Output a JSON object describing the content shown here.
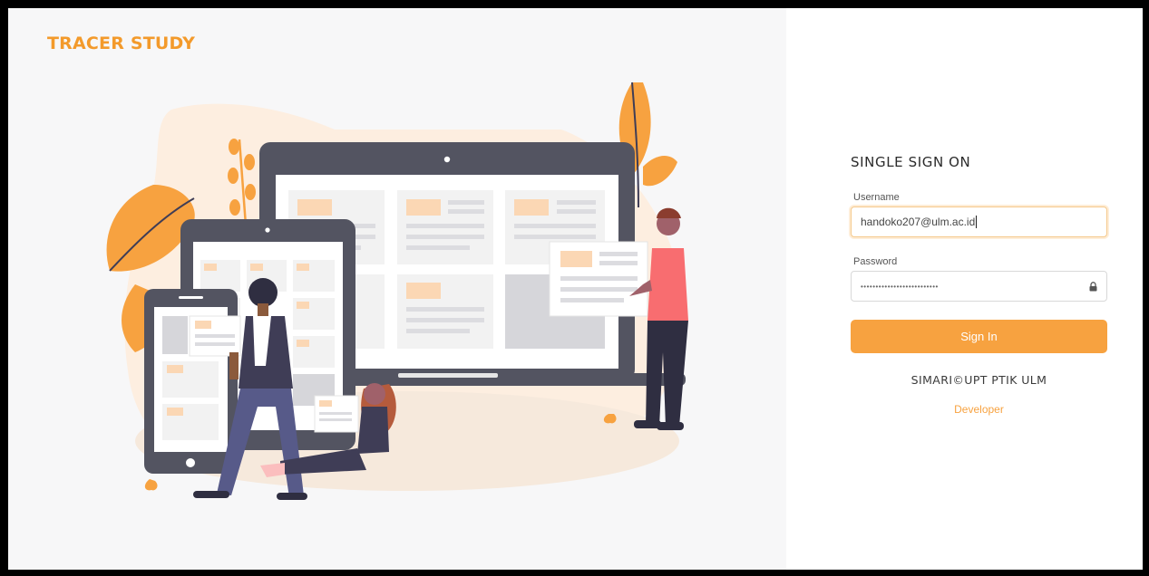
{
  "brand": {
    "title": "TRACER STUDY"
  },
  "login": {
    "title": "SINGLE SIGN ON",
    "username_label": "Username",
    "username_value": "handoko207@ulm.ac.id",
    "password_label": "Password",
    "password_masked": "••••••••••••••••••••••••••",
    "lock_icon": "lock-icon",
    "signin_label": "Sign In",
    "footer": "SIMARI©UPT PTIK ULM",
    "developer_link": "Developer"
  },
  "colors": {
    "accent": "#f7a240",
    "brand": "#f39a2b",
    "dark_device": "#535461",
    "page_bg": "#f7f7f8"
  }
}
